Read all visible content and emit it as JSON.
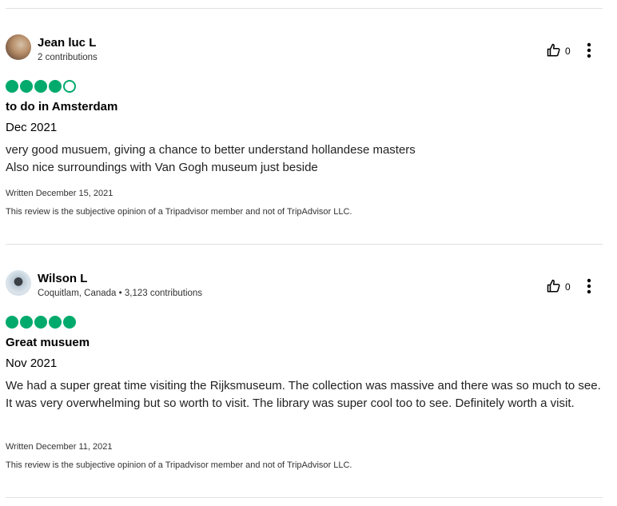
{
  "reviews": [
    {
      "author": "Jean luc L",
      "meta": "2 contributions",
      "helpful_votes": "0",
      "rating": 4,
      "title": "to do in Amsterdam",
      "date_of_visit": "Dec 2021",
      "body": [
        "very good musuem, giving a chance to better understand hollandese masters",
        "Also nice surroundings with Van Gogh museum just beside"
      ],
      "written": "Written December 15, 2021",
      "disclaimer": "This review is the subjective opinion of a Tripadvisor member and not of TripAdvisor LLC."
    },
    {
      "author": "Wilson L",
      "meta": "Coquitlam, Canada • 3,123 contributions",
      "helpful_votes": "0",
      "rating": 5,
      "title": "Great musuem",
      "date_of_visit": "Nov 2021",
      "body": [
        "We had a super great time visiting the Rijksmuseum. The collection was massive and there was so much to see. It was very overwhelming but so worth to visit. The library was super cool too to see. Definitely worth a visit."
      ],
      "written": "Written December 11, 2021",
      "disclaimer": "This review is the subjective opinion of a Tripadvisor member and not of TripAdvisor LLC."
    }
  ],
  "colors": {
    "bubble": "#00aa6c",
    "divider": "#e0e0e0"
  },
  "icons": {
    "helpful": "thumbs-up-icon",
    "more": "more-vertical-icon"
  }
}
